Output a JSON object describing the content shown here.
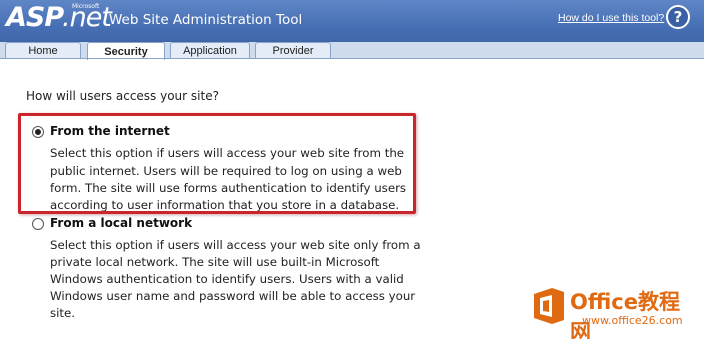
{
  "header": {
    "logo_asp": "ASP",
    "logo_net": ".net",
    "logo_microsoft": "Microsoft",
    "title": "Web Site Administration Tool",
    "help_link": "How do I use this tool?",
    "help_icon": "help-icon",
    "help_icon_glyph": "?",
    "colors": {
      "header_bg": "#4a72b6",
      "text": "#ffffff"
    }
  },
  "tabs": [
    {
      "label": "Home",
      "active": false
    },
    {
      "label": "Security",
      "active": true
    },
    {
      "label": "Application",
      "active": false
    },
    {
      "label": "Provider",
      "active": false
    }
  ],
  "main": {
    "question": "How will users access your site?",
    "options": [
      {
        "label": "From the internet",
        "selected": true,
        "description_lines": [
          "Select this option if users will access your web site from the",
          "public internet. Users will be required to log on using a web",
          "form. The site will use forms authentication to identify users",
          "according to user information that you store in a database."
        ]
      },
      {
        "label": "From a local network",
        "selected": false,
        "description_lines": [
          "Select this option if users will access your web site only from a",
          "private local network. The site will use built-in Microsoft",
          "Windows authentication to identify users. Users with a valid",
          "Windows user name and password will be able to access your",
          "site."
        ]
      }
    ],
    "highlight_color": "#c9252a"
  },
  "watermark": {
    "text": "Office教程网",
    "url": "www.office26.com",
    "color": "#e06a12"
  }
}
